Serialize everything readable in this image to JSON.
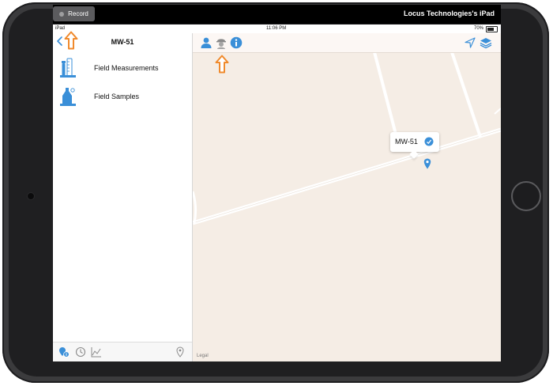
{
  "recording_bar": {
    "record_label": "Record",
    "device_name": "Locus Technologies's iPad"
  },
  "status_bar": {
    "carrier": "iPad",
    "time": "11:06 PM",
    "battery_text": "70%",
    "battery_level": 0.7
  },
  "sidebar": {
    "title": "MW-51",
    "items": [
      {
        "label": "Field Measurements",
        "icon": "field-measurements-icon"
      },
      {
        "label": "Field Samples",
        "icon": "field-samples-icon"
      }
    ],
    "bottom_icons": [
      "location-info-icon",
      "history-icon",
      "chart-icon",
      "map-pin-icon"
    ]
  },
  "map": {
    "toolbar_icons": [
      "user-icon",
      "field-tech-icon",
      "info-icon",
      "navigation-arrow-icon",
      "layers-icon"
    ],
    "callout_label": "MW-51",
    "legal_text": "Legal"
  },
  "colors": {
    "accent_blue": "#3a8fd8",
    "highlight_orange": "#f08a2c",
    "map_background": "#f5ede5",
    "road": "#ffffff"
  }
}
